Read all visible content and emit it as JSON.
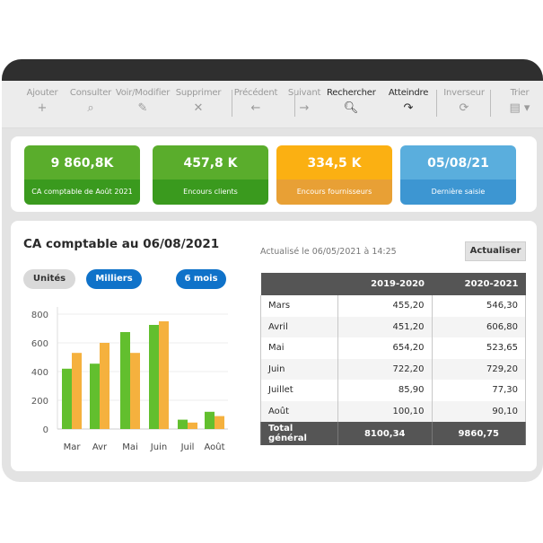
{
  "toolbar": {
    "items": [
      {
        "label": "Ajouter",
        "icon": "plus-icon",
        "glyph": "+"
      },
      {
        "label": "Consulter",
        "icon": "magnifier-icon",
        "glyph": "⌕"
      },
      {
        "label": "Voir/Modifier",
        "icon": "pencil-icon",
        "glyph": "✎"
      },
      {
        "label": "Supprimer",
        "icon": "close-icon",
        "glyph": "✕"
      },
      {
        "label": "Précédent",
        "icon": "arrow-left-icon",
        "glyph": "←"
      },
      {
        "label": "Suivant",
        "icon": "arrow-right-icon",
        "glyph": "→"
      },
      {
        "label": "Rechercher",
        "icon": "search-icon",
        "glyph": "🔍︎"
      },
      {
        "label": "Atteindre",
        "icon": "redo-arrow-icon",
        "glyph": "↷"
      },
      {
        "label": "Inverseur",
        "icon": "refresh-icon",
        "glyph": "⟳"
      },
      {
        "label": "Trier",
        "icon": "document-dropdown-icon",
        "glyph": "▤ ▾"
      }
    ]
  },
  "kpis": [
    {
      "value": "9 860,8K",
      "caption": "CA comptable de Août 2021",
      "top": "#5aad2c",
      "bottom": "#3a9a1e"
    },
    {
      "value": "457,8 K",
      "caption": "Encours clients",
      "top": "#5aad2c",
      "bottom": "#3a9a1e"
    },
    {
      "value": "334,5 K",
      "caption": "Encours fournisseurs",
      "top": "#fbb012",
      "bottom": "#e8a035"
    },
    {
      "value": "05/08/21",
      "caption": "Dernière saisie",
      "top": "#5aaedd",
      "bottom": "#3d96d2"
    }
  ],
  "main": {
    "title": "CA comptable au 06/08/2021",
    "updated": "Actualisé le 06/05/2021 à 14:25",
    "refresh_label": "Actualiser",
    "pills": {
      "units": "Unités",
      "thousands": "Milliers",
      "period": "6 mois"
    }
  },
  "table": {
    "headers": [
      "",
      "2019-2020",
      "2020-2021"
    ],
    "rows": [
      [
        "Mars",
        "455,20",
        "546,30"
      ],
      [
        "Avril",
        "451,20",
        "606,80"
      ],
      [
        "Mai",
        "654,20",
        "523,65"
      ],
      [
        "Juin",
        "722,20",
        "729,20"
      ],
      [
        "Juillet",
        "85,90",
        "77,30"
      ],
      [
        "Août",
        "100,10",
        "90,10"
      ]
    ],
    "total": [
      "Total général",
      "8100,34",
      "9860,75"
    ]
  },
  "chart_data": {
    "type": "bar",
    "categories": [
      "Mar",
      "Avr",
      "Mai",
      "Juin",
      "Juil",
      "Août"
    ],
    "series": [
      {
        "name": "2019-2020",
        "color": "#62bf2e",
        "values": [
          420,
          455,
          675,
          725,
          65,
          120
        ]
      },
      {
        "name": "2020-2021",
        "color": "#f5b13e",
        "values": [
          530,
          600,
          530,
          750,
          45,
          90
        ]
      }
    ],
    "yticks": [
      0,
      200,
      400,
      600,
      800
    ],
    "ylim": [
      0,
      850
    ],
    "grid": true,
    "title": "",
    "xlabel": "",
    "ylabel": ""
  }
}
